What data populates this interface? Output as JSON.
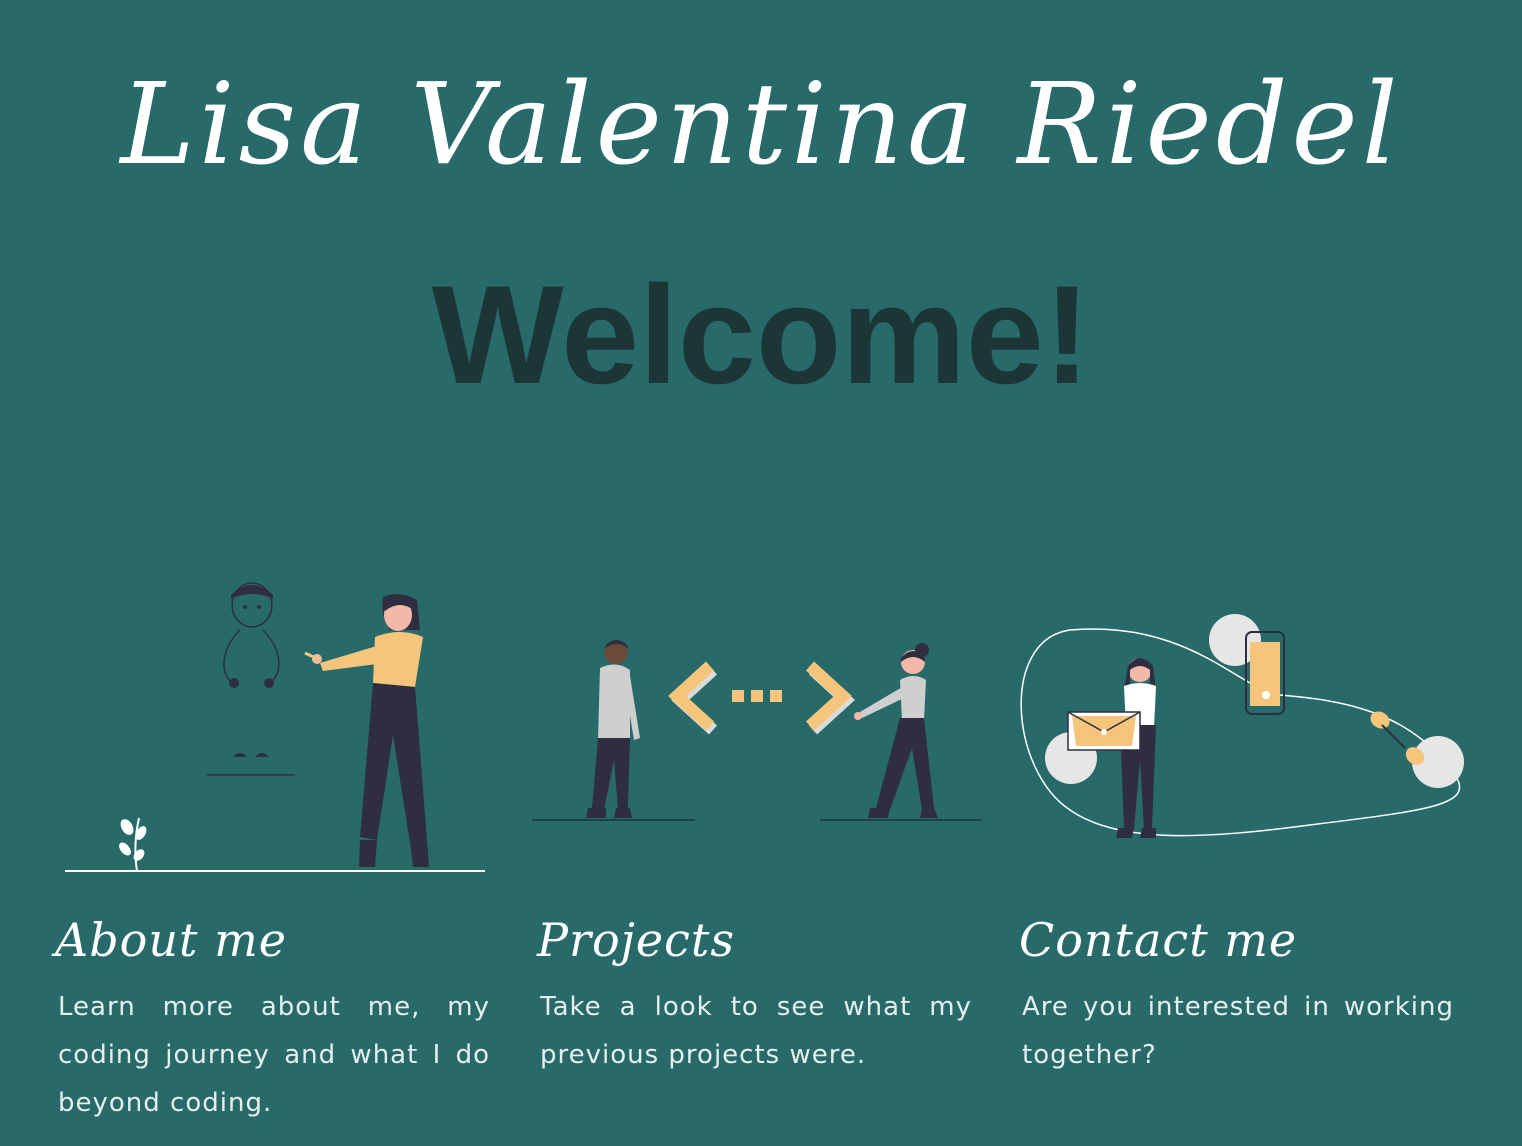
{
  "header": {
    "site_title": "Lisa Valentina Riedel",
    "welcome": "Welcome!"
  },
  "colors": {
    "background": "#286a6a",
    "welcome_text": "#1c3537",
    "accent_yellow": "#f5c57c",
    "figure_dark": "#2f2e41",
    "figure_grey": "#cfcfcf"
  },
  "cards": [
    {
      "title": "About me",
      "text": "Learn more about me, my coding journey and what I do beyond coding.",
      "illustration": "woman-pointing-at-stick-figure-illustration"
    },
    {
      "title": "Projects",
      "text": "Take a look to see what my previous projects were.",
      "illustration": "two-people-code-brackets-illustration"
    },
    {
      "title": "Contact me",
      "text": "Are you interested in working together?",
      "illustration": "woman-with-envelope-and-phone-illustration"
    }
  ]
}
